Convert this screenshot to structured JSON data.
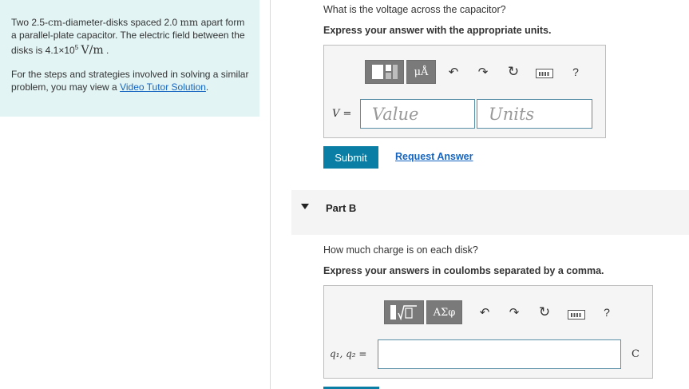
{
  "problem": {
    "line1": "Two 2.5-",
    "unit_cm": "cm",
    "line1b": "-diameter-disks spaced 2.0 ",
    "unit_mm": "mm",
    "line1c": " apart form a parallel-plate capacitor. The electric field between the disks is 4.1×10",
    "exp": "5",
    "field_unit": "V/m",
    "period": " .",
    "help_text": "For the steps and strategies involved in solving a similar problem, you may view a ",
    "help_link": "Video Tutor Solution",
    "help_end": "."
  },
  "partA": {
    "question": "What is the voltage across the capacitor?",
    "instruction": "Express your answer with the appropriate units.",
    "unit_button_label": "μÅ",
    "help_icon": "?",
    "var_label": "V =",
    "value_placeholder": "Value",
    "units_placeholder": "Units",
    "submit_label": "Submit",
    "request_label": "Request Answer"
  },
  "partB": {
    "label": "Part B",
    "question": "How much charge is on each disk?",
    "instruction": "Express your answers in coulombs separated by a comma.",
    "greek_button_label": "ΑΣφ",
    "help_icon": "?",
    "var_label": "q₁, q₂ =",
    "unit": "C"
  },
  "icons": {
    "undo": "undo-icon",
    "redo": "redo-icon",
    "reset": "reset-icon",
    "keyboard": "keyboard-icon"
  },
  "colors": {
    "accent": "#0a7ea4",
    "link": "#1565c0",
    "panel": "#e3f4f4"
  }
}
